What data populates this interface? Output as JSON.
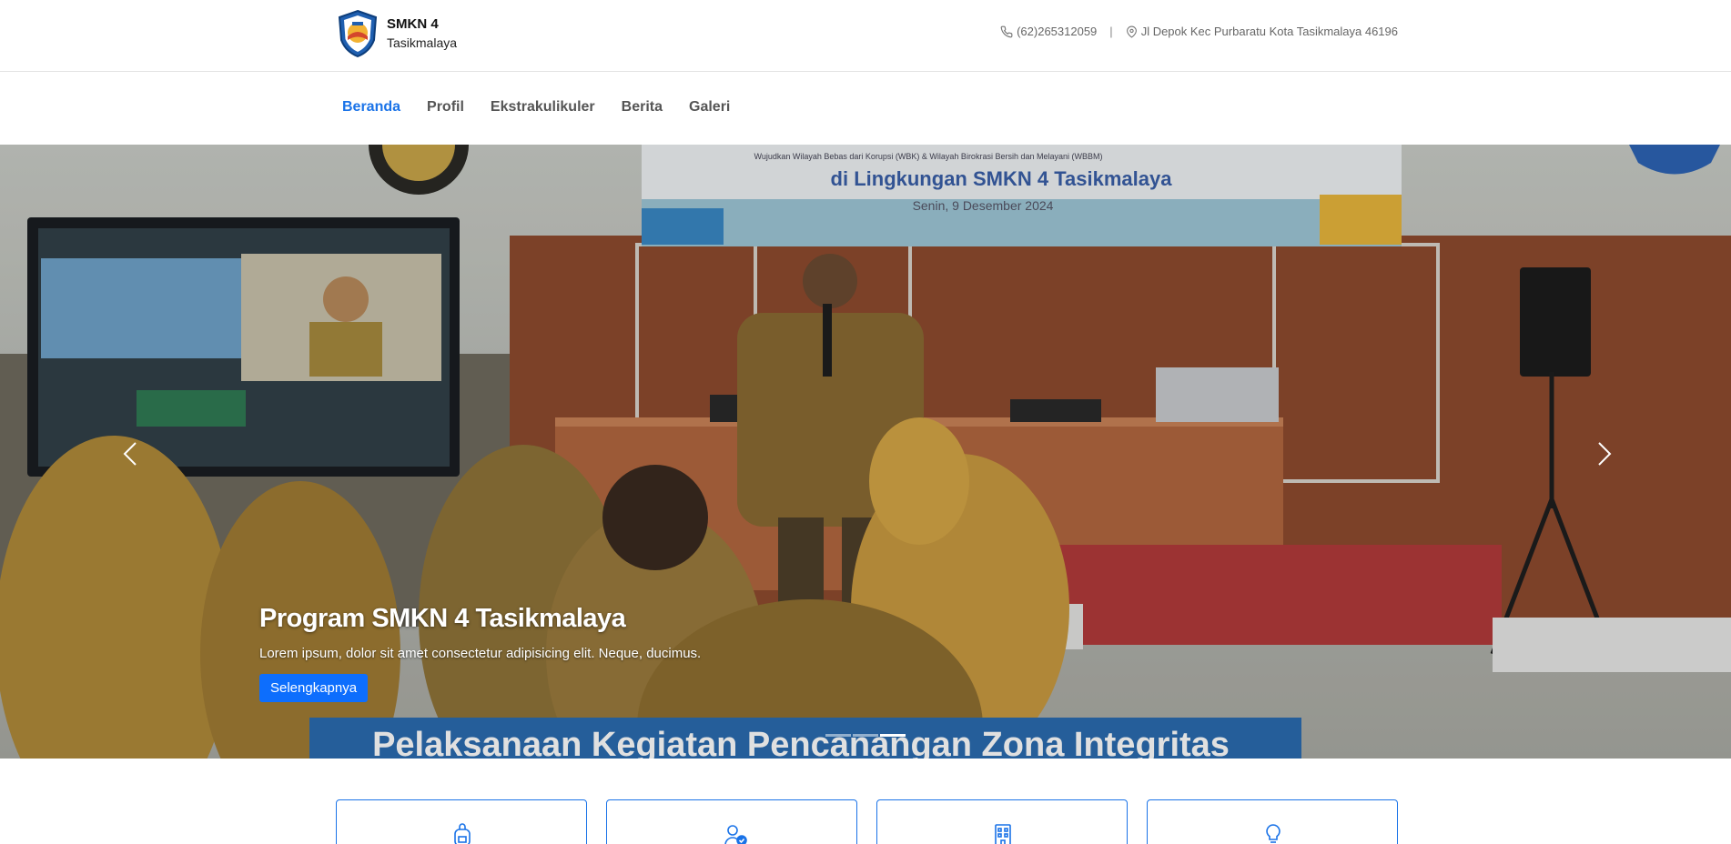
{
  "header": {
    "school_name": "SMKN 4",
    "school_city": "Tasikmalaya",
    "phone": "(62)265312059",
    "separator": "|",
    "address": "Jl Depok Kec Purbaratu Kota Tasikmalaya 46196"
  },
  "nav": {
    "items": [
      {
        "label": "Beranda",
        "active": true
      },
      {
        "label": "Profil",
        "active": false
      },
      {
        "label": "Ekstrakulikuler",
        "active": false
      },
      {
        "label": "Berita",
        "active": false
      },
      {
        "label": "Galeri",
        "active": false
      }
    ]
  },
  "hero": {
    "title": "Program SMKN 4 Tasikmalaya",
    "text": "Lorem ipsum, dolor sit amet consectetur adipisicing elit. Neque, ducimus.",
    "button_label": "Selengkapnya",
    "banner_line_small": "Wujudkan Wilayah Bebas dari Korupsi (WBK) & Wilayah Birokrasi Bersih dan Melayani (WBBM)",
    "banner_line_big": "di Lingkungan SMKN 4 Tasikmalaya",
    "banner_date": "Senin, 9 Desember 2024",
    "bottom_banner": "Pelaksanaan Kegiatan Pencanangan Zona Integritas",
    "slide_count": 3,
    "active_slide": 3
  },
  "cards": [
    {
      "icon": "backpack-icon"
    },
    {
      "icon": "user-check-icon"
    },
    {
      "icon": "building-icon"
    },
    {
      "icon": "lightbulb-icon"
    }
  ],
  "colors": {
    "accent": "#1a73e8",
    "button": "#0d6efd",
    "nav_text": "#555555"
  }
}
